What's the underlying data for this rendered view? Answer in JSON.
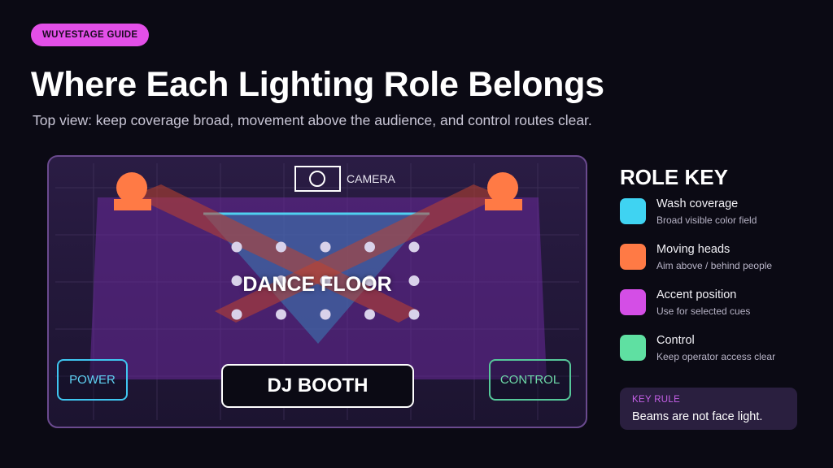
{
  "badge": "WUYESTAGE GUIDE",
  "title": "Where Each Lighting Role Belongs",
  "subtitle": "Top view: keep coverage broad, movement above the audience, and control routes clear.",
  "stage": {
    "camera_label": "CAMERA",
    "dance_floor_label": "DANCE FLOOR",
    "power_label": "POWER",
    "control_label": "CONTROL",
    "dj_booth_label": "DJ BOOTH",
    "audience_dot_rows": 3,
    "audience_dot_cols": 5
  },
  "role_key": {
    "title": "ROLE KEY",
    "items": [
      {
        "label": "Wash coverage",
        "description": "Broad visible color field",
        "color": "#3fd3f2"
      },
      {
        "label": "Moving heads",
        "description": "Aim above / behind people",
        "color": "#ff7a45"
      },
      {
        "label": "Accent position",
        "description": "Use for selected cues",
        "color": "#d44ee6"
      },
      {
        "label": "Control",
        "description": "Keep operator access clear",
        "color": "#5fe0a2"
      }
    ]
  },
  "key_rule": {
    "label": "KEY RULE",
    "text": "Beams are not face light."
  },
  "colors": {
    "background": "#0b0a14",
    "badge": "#e34fe8",
    "stage_border": "#6a4a8e",
    "stage_fill": "#2b1b45",
    "moving_head": "#ff7a45"
  }
}
